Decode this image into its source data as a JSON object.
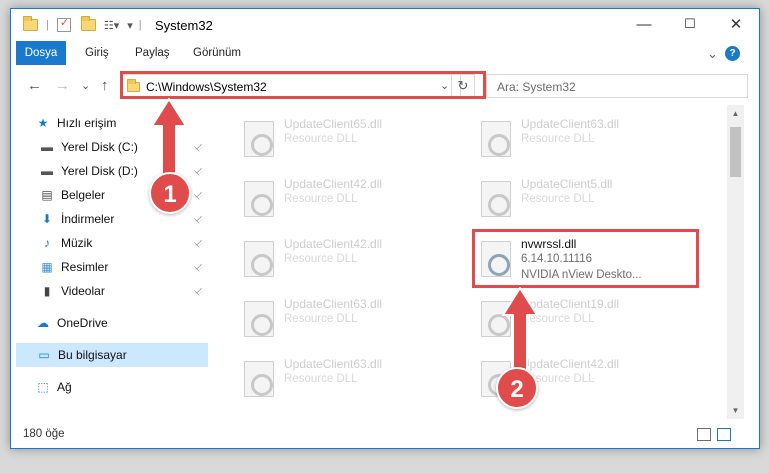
{
  "window": {
    "title": "System32",
    "minimize": "—",
    "maximize": "☐",
    "close": "✕"
  },
  "ribbon": {
    "tabs": [
      "Dosya",
      "Giriş",
      "Paylaş",
      "Görünüm"
    ],
    "expand": "⌄",
    "help": "?"
  },
  "nav": {
    "back": "←",
    "forward": "→",
    "up_menu": "⌄",
    "up": "↑",
    "address": "C:\\Windows\\System32",
    "refresh": "↻",
    "search_placeholder": "Ara: System32"
  },
  "sidebar": {
    "items": [
      {
        "label": "Hızlı erişim",
        "icon": "star-icon",
        "glyph": "★",
        "color": "#1979ca",
        "pinned": false
      },
      {
        "label": "Yerel Disk (C:)",
        "icon": "drive-icon",
        "glyph": "▬",
        "color": "#555555",
        "pinned": true
      },
      {
        "label": "Yerel Disk (D:)",
        "icon": "drive-icon",
        "glyph": "▬",
        "color": "#555555",
        "pinned": true
      },
      {
        "label": "Belgeler",
        "icon": "documents-icon",
        "glyph": "▤",
        "color": "#4a4a4a",
        "pinned": true
      },
      {
        "label": "İndirmeler",
        "icon": "download-icon",
        "glyph": "⬇",
        "color": "#1979ca",
        "pinned": true
      },
      {
        "label": "Müzik",
        "icon": "music-icon",
        "glyph": "♪",
        "color": "#1979ca",
        "pinned": true
      },
      {
        "label": "Resimler",
        "icon": "pictures-icon",
        "glyph": "▦",
        "color": "#3a8fd0",
        "pinned": true
      },
      {
        "label": "Videolar",
        "icon": "videos-icon",
        "glyph": "▮",
        "color": "#444444",
        "pinned": true
      },
      {
        "label": "OneDrive",
        "icon": "cloud-icon",
        "glyph": "☁",
        "color": "#1979ca",
        "pinned": false
      },
      {
        "label": "Bu bilgisayar",
        "icon": "computer-icon",
        "glyph": "▭",
        "color": "#1979ca",
        "pinned": false
      },
      {
        "label": "Ağ",
        "icon": "network-icon",
        "glyph": "⬚",
        "color": "#1979ca",
        "pinned": false
      }
    ],
    "pin_glyph": "📌"
  },
  "files": [
    {
      "name": "UpdateClient65.dll",
      "desc": "Resource DLL"
    },
    {
      "name": "UpdateClient63.dll",
      "desc": "Resource DLL"
    },
    {
      "name": "UpdateClient42.dll",
      "desc": "Resource DLL"
    },
    {
      "name": "UpdateClient5.dll",
      "desc": "Resource DLL"
    },
    {
      "name": "UpdateClient42.dll",
      "desc": "Resource DLL"
    },
    {
      "name": "nvwrssl.dll",
      "desc": "6.14.10.11116",
      "desc2": "NVIDIA nView Deskto..."
    },
    {
      "name": "UpdateClient63.dll",
      "desc": "Resource DLL"
    },
    {
      "name": "UpdateClient19.dll",
      "desc": "Resource DLL"
    },
    {
      "name": "UpdateClient63.dll",
      "desc": "Resource DLL"
    },
    {
      "name": "UpdateClient42.dll",
      "desc": "Resource DLL"
    }
  ],
  "status": {
    "count": "180 öğe"
  },
  "annotations": {
    "step1": "1",
    "step2": "2",
    "accent": "#e04b4b"
  }
}
